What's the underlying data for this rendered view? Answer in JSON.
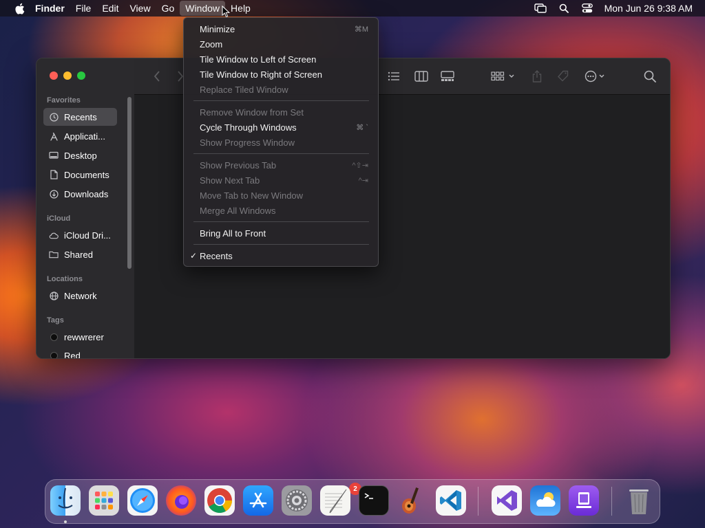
{
  "menubar": {
    "app_name": "Finder",
    "menus": [
      "File",
      "Edit",
      "View",
      "Go",
      "Window",
      "Help"
    ],
    "active_menu": "Window",
    "clock": "Mon Jun 26  9:38 AM"
  },
  "window_menu": {
    "items": [
      {
        "label": "Minimize",
        "shortcut": "⌘M",
        "enabled": true
      },
      {
        "label": "Zoom",
        "shortcut": "",
        "enabled": true
      },
      {
        "label": "Tile Window to Left of Screen",
        "shortcut": "",
        "enabled": true
      },
      {
        "label": "Tile Window to Right of Screen",
        "shortcut": "",
        "enabled": true
      },
      {
        "label": "Replace Tiled Window",
        "shortcut": "",
        "enabled": false
      },
      {
        "label": "Remove Window from Set",
        "shortcut": "",
        "enabled": false
      },
      {
        "label": "Cycle Through Windows",
        "shortcut": "⌘ `",
        "enabled": true
      },
      {
        "label": "Show Progress Window",
        "shortcut": "",
        "enabled": false
      },
      {
        "label": "Show Previous Tab",
        "shortcut": "^⇧⇥",
        "enabled": false
      },
      {
        "label": "Show Next Tab",
        "shortcut": "^⇥",
        "enabled": false
      },
      {
        "label": "Move Tab to New Window",
        "shortcut": "",
        "enabled": false
      },
      {
        "label": "Merge All Windows",
        "shortcut": "",
        "enabled": false
      },
      {
        "label": "Bring All to Front",
        "shortcut": "",
        "enabled": true
      },
      {
        "label": "Recents",
        "shortcut": "",
        "enabled": true,
        "checked": true
      }
    ]
  },
  "sidebar": {
    "favorites_header": "Favorites",
    "favorites": [
      {
        "label": "Recents",
        "icon": "clock-icon",
        "selected": true
      },
      {
        "label": "Applicati...",
        "icon": "applications-icon"
      },
      {
        "label": "Desktop",
        "icon": "desktop-icon"
      },
      {
        "label": "Documents",
        "icon": "document-icon"
      },
      {
        "label": "Downloads",
        "icon": "download-icon"
      }
    ],
    "icloud_header": "iCloud",
    "icloud": [
      {
        "label": "iCloud Dri...",
        "icon": "cloud-icon"
      },
      {
        "label": "Shared",
        "icon": "shared-folder-icon"
      }
    ],
    "locations_header": "Locations",
    "locations": [
      {
        "label": "Network",
        "icon": "globe-icon"
      }
    ],
    "tags_header": "Tags",
    "tags": [
      {
        "label": "rewwrerer",
        "color": "#0d0d0d"
      },
      {
        "label": "Red",
        "color": "#0d0d0d"
      }
    ]
  },
  "dock": {
    "apps": [
      "finder",
      "launchpad",
      "safari",
      "firefox",
      "chrome",
      "app-store",
      "system-settings",
      "textedit",
      "terminal",
      "garageband",
      "vscode",
      "visual-studio",
      "weather",
      "simulator",
      "trash"
    ],
    "settings_badge": "2"
  },
  "colors": {
    "close": "#ff5f57",
    "minimize": "#febc2e",
    "zoom": "#28c840",
    "menu_highlight": "#5a5960"
  }
}
